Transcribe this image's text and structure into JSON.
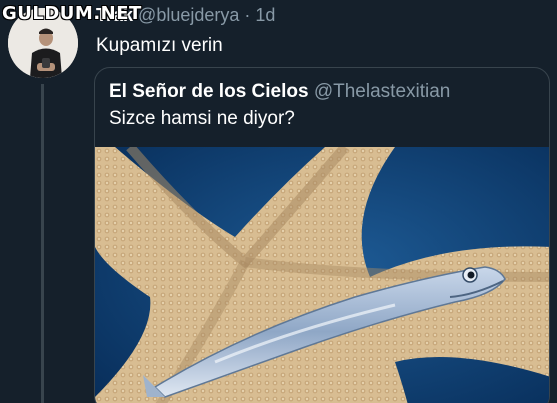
{
  "watermark": {
    "text": "GULDUM.NET"
  },
  "tweet": {
    "display_name": "Trak",
    "handle": "@bluejderya",
    "separator": "·",
    "time": "1d",
    "text": "Kupamızı verin"
  },
  "quoted_tweet": {
    "display_name": "El Señor de los Cielos",
    "handle": "@Thelastexitian",
    "text": "Sizce hamsi ne diyor?"
  },
  "colors": {
    "background": "#15202b",
    "border": "#38444d",
    "secondary_text": "#8899a6"
  }
}
